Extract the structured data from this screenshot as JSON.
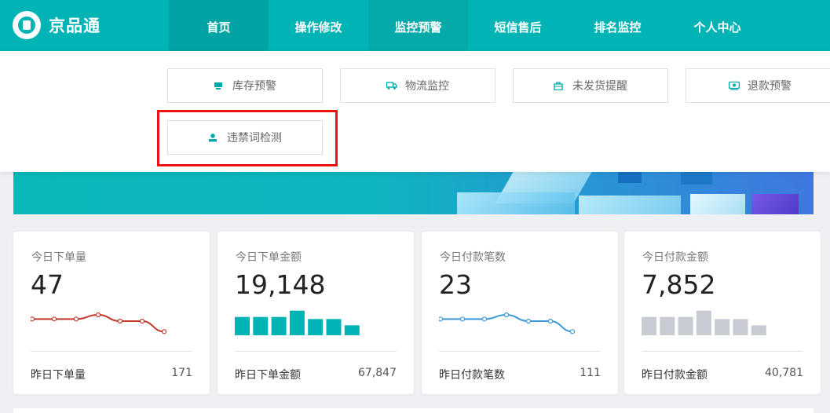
{
  "app": {
    "title": "京品通"
  },
  "nav": [
    {
      "label": "首页"
    },
    {
      "label": "操作修改"
    },
    {
      "label": "监控预警"
    },
    {
      "label": "短信售后"
    },
    {
      "label": "排名监控"
    },
    {
      "label": "个人中心"
    }
  ],
  "dropdown": {
    "items": [
      {
        "label": "库存预警",
        "icon": "inventory-icon"
      },
      {
        "label": "物流监控",
        "icon": "truck-icon"
      },
      {
        "label": "未发货提醒",
        "icon": "bag-icon"
      },
      {
        "label": "退款预警",
        "icon": "refund-icon"
      },
      {
        "label": "违禁词检测",
        "icon": "person-icon"
      }
    ]
  },
  "colors": {
    "brand": "#00b3b4",
    "nav_active": "#02a3a5",
    "highlight": "#ee1111",
    "red_line": "#c0392b",
    "teal_bar": "#00b3b4",
    "blue_line": "#3a9ad9",
    "gray_bar": "#c8ccd2"
  },
  "cards": [
    {
      "title": "今日下单量",
      "value": "47",
      "foot_label": "昨日下单量",
      "foot_value": "171",
      "chart": {
        "type": "line",
        "values": [
          5,
          5,
          5,
          7,
          4,
          4,
          -1
        ]
      }
    },
    {
      "title": "今日下单金额",
      "value": "19,148",
      "foot_label": "昨日下单金额",
      "foot_value": "67,847",
      "chart": {
        "type": "bar",
        "values": [
          6,
          6,
          6,
          9,
          5,
          5,
          2
        ]
      }
    },
    {
      "title": "今日付款笔数",
      "value": "23",
      "foot_label": "昨日付款笔数",
      "foot_value": "111",
      "chart": {
        "type": "line",
        "values": [
          5,
          5,
          5,
          7,
          4,
          4,
          -1
        ]
      }
    },
    {
      "title": "今日付款金额",
      "value": "7,852",
      "foot_label": "昨日付款金额",
      "foot_value": "40,781",
      "chart": {
        "type": "bar",
        "values": [
          6,
          6,
          6,
          9,
          5,
          5,
          2
        ]
      }
    }
  ]
}
